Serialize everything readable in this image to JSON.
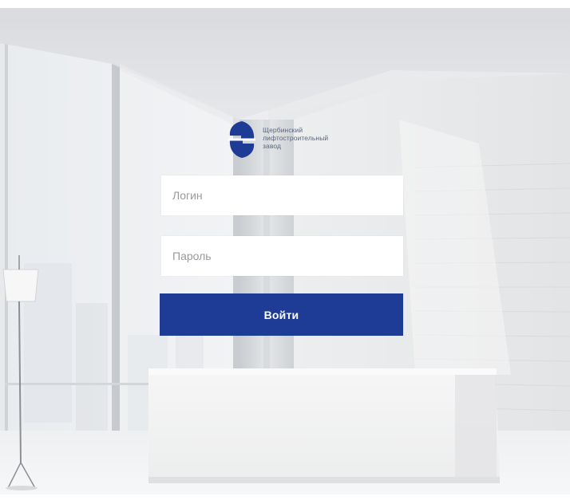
{
  "logo": {
    "line1": "Щербинский",
    "line2": "лифтостроительный",
    "line3": "завод"
  },
  "form": {
    "login_placeholder": "Логин",
    "password_placeholder": "Пароль",
    "submit_label": "Войти"
  },
  "colors": {
    "brand": "#1e3b95",
    "background": "#e8eaec"
  },
  "icons": {
    "logo": "company-logo-icon"
  }
}
